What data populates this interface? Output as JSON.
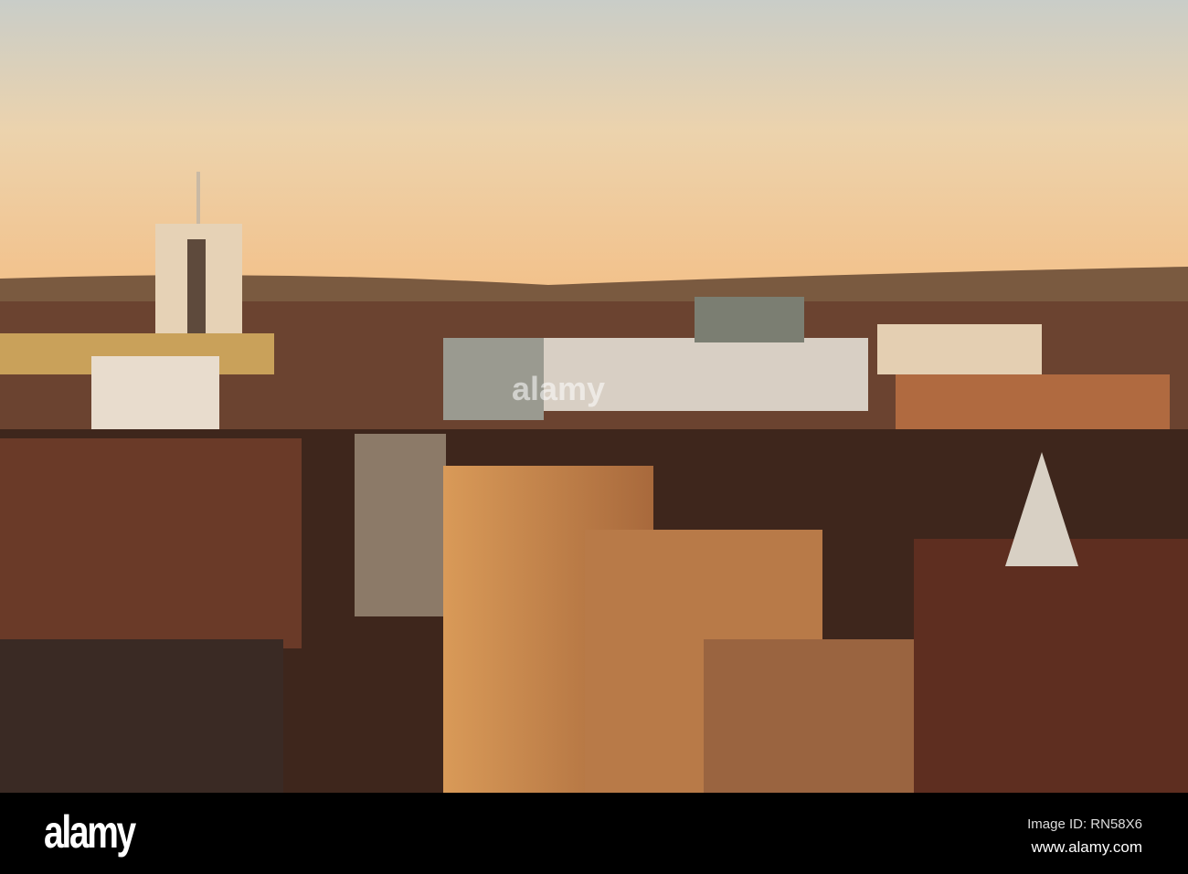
{
  "photo": {
    "subject": "city-skyline-at-sunset",
    "colors": {
      "sky_top": "#cfd0c8",
      "sky_mid": "#efd2a8",
      "horizon": "#f2c48c",
      "brick": "#8a4a2e",
      "lit_facade": "#c98a4e",
      "shadow": "#2a1a14"
    }
  },
  "watermark": {
    "text": "alamy"
  },
  "footer": {
    "logo": "alamy",
    "image_id": "Image ID: RN58X6",
    "website": "www.alamy.com"
  }
}
